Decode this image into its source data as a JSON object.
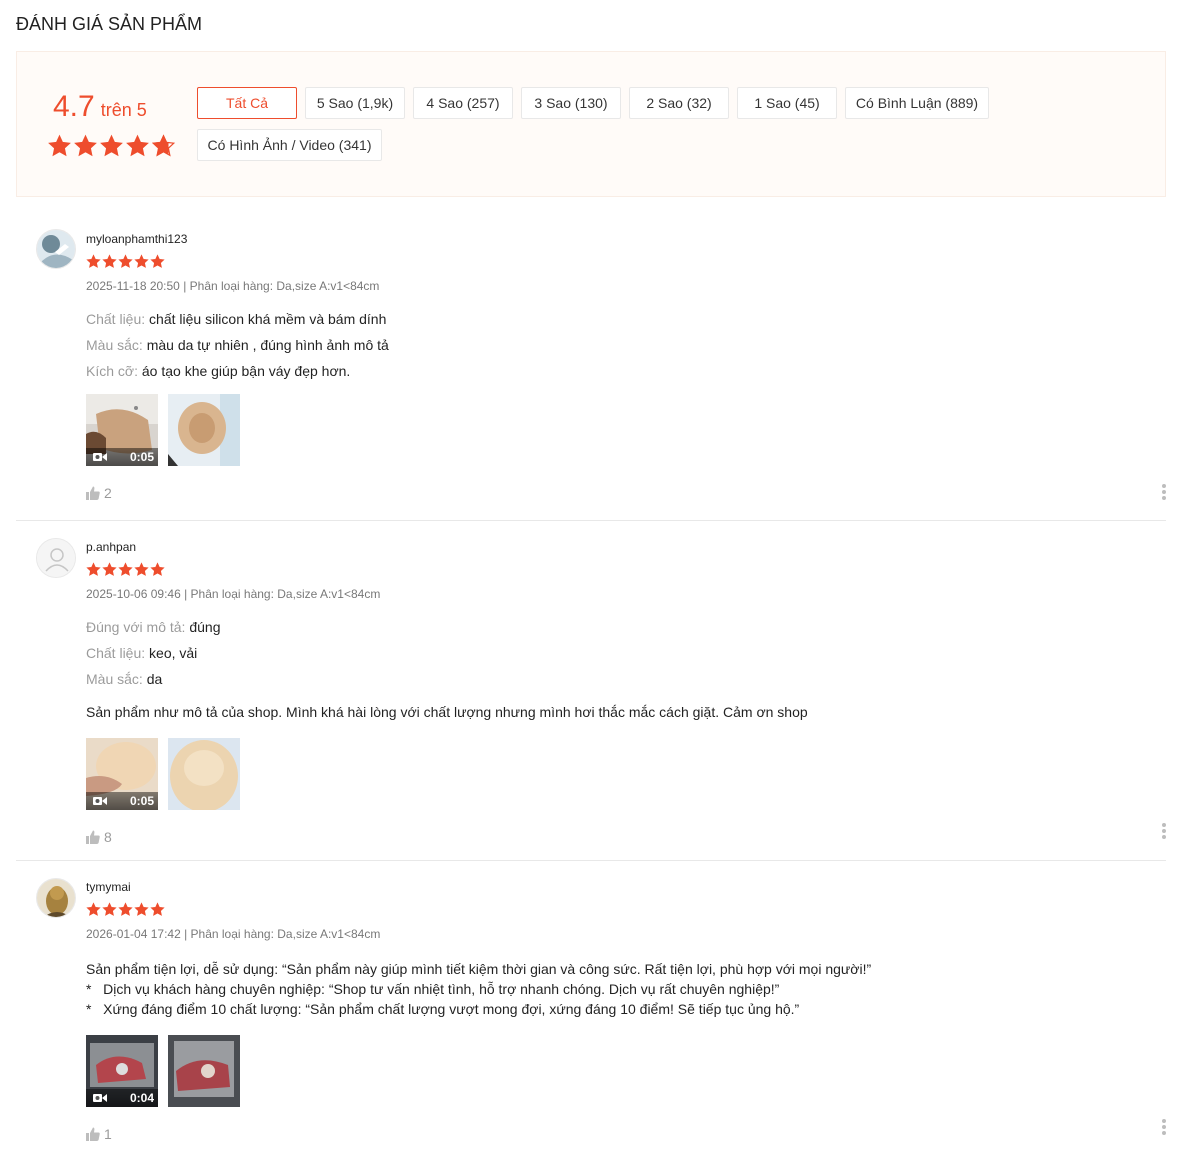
{
  "title": "ĐÁNH GIÁ SẢN PHẨM",
  "overview": {
    "rating": "4.7",
    "rating_suffix": "trên 5",
    "stars_value": 4.7,
    "filters": [
      {
        "label": "Tất Cả",
        "active": true
      },
      {
        "label": "5 Sao (1,9k)"
      },
      {
        "label": "4 Sao (257)"
      },
      {
        "label": "3 Sao (130)"
      },
      {
        "label": "2 Sao (32)"
      },
      {
        "label": "1 Sao (45)"
      },
      {
        "label": "Có Bình Luận (889)"
      },
      {
        "label": "Có Hình Ảnh / Video (341)"
      }
    ]
  },
  "reviews": [
    {
      "username": "myloanphamthi123",
      "stars": 5,
      "meta": "2025-11-18 20:50 | Phân loại hàng: Da,size A:v1<84cm",
      "attributes": [
        {
          "key": "Chất liệu:",
          "value": "chất liệu silicon khá mềm và bám dính"
        },
        {
          "key": "Màu sắc:",
          "value": "màu da tự nhiên , đúng hình ảnh mô tả"
        },
        {
          "key": "Kích cỡ:",
          "value": "áo tạo khe giúp bận váy đẹp hơn."
        }
      ],
      "comment": [],
      "video_duration": "0:05",
      "likes": "2"
    },
    {
      "username": "p.anhpan",
      "stars": 5,
      "meta": "2025-10-06 09:46 | Phân loại hàng: Da,size A:v1<84cm",
      "attributes": [
        {
          "key": "Đúng với mô tả:",
          "value": "đúng"
        },
        {
          "key": "Chất liệu:",
          "value": "keo, vải"
        },
        {
          "key": "Màu sắc:",
          "value": "da"
        }
      ],
      "comment": [
        "Sản phẩm như mô tả của shop. Mình khá hài lòng với chất lượng nhưng mình hơi thắc mắc cách giặt. Cảm ơn shop"
      ],
      "video_duration": "0:05",
      "likes": "8"
    },
    {
      "username": "tymymai",
      "stars": 5,
      "meta": "2026-01-04 17:42 | Phân loại hàng: Da,size A:v1<84cm",
      "attributes": [],
      "comment": [
        "Sản phẩm tiện lợi, dễ sử dụng: “Sản phẩm này giúp mình tiết kiệm thời gian và công sức. Rất tiện lợi, phù hợp với mọi người!”",
        "*   Dịch vụ khách hàng chuyên nghiệp: “Shop tư vấn nhiệt tình, hỗ trợ nhanh chóng. Dịch vụ rất chuyên nghiệp!”",
        "*   Xứng đáng điểm 10 chất lượng: “Sản phẩm chất lượng vượt mong đợi, xứng đáng 10 điểm! Sẽ tiếp tục ủng hộ.”"
      ],
      "video_duration": "0:04",
      "likes": "1"
    }
  ],
  "colors": {
    "accent": "#ee4d2d",
    "overview_bg": "#fffbf8"
  }
}
